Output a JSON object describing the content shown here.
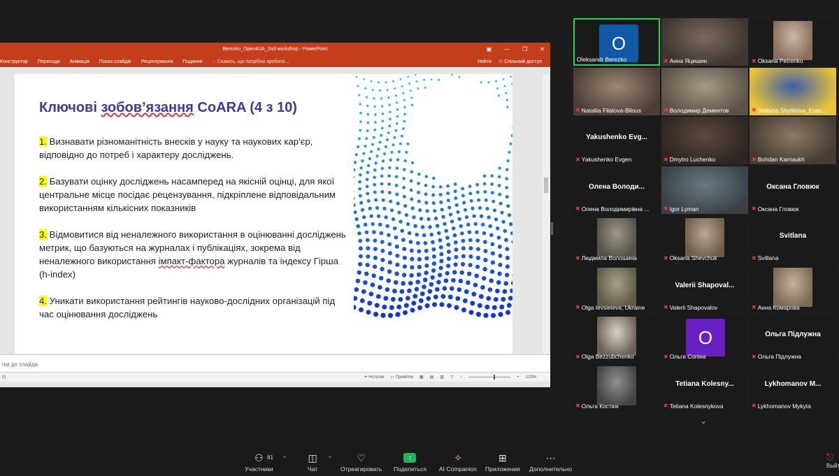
{
  "ppt": {
    "window_title": "Berezko_Open4UA_2nd-workshop - PowerPoint",
    "ribbon_tabs": [
      "Конструктор",
      "Переходи",
      "Анімація",
      "Показ слайдів",
      "Рецензування",
      "Подання"
    ],
    "tell_me": "Скажіть, що потрібно зробити...",
    "share_label": "Спільний доступ",
    "help_label": "Увійти",
    "notes_placeholder": "тки до слайда",
    "status_left": "ті)",
    "status_notes": "Нотатки",
    "status_comments": "Примітки",
    "zoom": "123%"
  },
  "slide": {
    "title_a": "Ключові ",
    "title_b": "зобов’язання",
    "title_c": " CoARA (4 з 10)",
    "points": [
      {
        "num": "1.",
        "text": " Визнавати різноманітність внесків у науку та наукових кар'єр, відповідно до потреб і характеру досліджень."
      },
      {
        "num": "2.",
        "text": " Базувати оцінку досліджень насамперед на якісній оцінці, для якої центральне місце посідає рецензування, підкріплене відповідальним використанням кількісних показників"
      },
      {
        "num": "3.",
        "text_a": " Відмовитися від неналежного використання в оцінюванні досліджень метрик, що базуються на журналах і публікаціях, зокрема від неналежного використання ",
        "text_b": "імпакт-фактора",
        "text_c": " журналів та індексу Гірша (h-index)"
      },
      {
        "num": "4.",
        "text": " Уникати використання рейтингів науково-дослідних організацій під час оцінювання досліджень"
      }
    ]
  },
  "participants": [
    {
      "name": "Oleksandr Berezko",
      "type": "avatar",
      "letter": "O",
      "color": "#0e5aa7",
      "muted": false,
      "speaking": true
    },
    {
      "name": "Анна Яцишин",
      "type": "photo",
      "muted": true
    },
    {
      "name": "Oksana Petrenko",
      "type": "photo",
      "muted": true
    },
    {
      "name": "Nataliia Filatova-Bilous",
      "type": "photo",
      "muted": true
    },
    {
      "name": "Володимир Дементов",
      "type": "photo",
      "muted": true
    },
    {
      "name": "Svitlana Shytikova_Eras...",
      "type": "photo",
      "muted": true
    },
    {
      "name": "Yakushenko Evgen",
      "type": "text",
      "big": "Yakushenko Evg...",
      "muted": true
    },
    {
      "name": "Dmytro Luchenko",
      "type": "photo",
      "muted": true
    },
    {
      "name": "Bohdan Karnaukh",
      "type": "photo",
      "muted": true
    },
    {
      "name": "Олена Володимирівна ...",
      "type": "text",
      "big": "Олена Володи...",
      "muted": true
    },
    {
      "name": "Igor Lyman",
      "type": "photo",
      "muted": true
    },
    {
      "name": "Оксана Гловюк",
      "type": "text",
      "big": "Оксана Гловюк",
      "muted": true
    },
    {
      "name": "Людмила Волошина",
      "type": "photo",
      "muted": true
    },
    {
      "name": "Oksana Shevchuk",
      "type": "photo",
      "muted": true
    },
    {
      "name": "Svitlana",
      "type": "text",
      "big": "Svitlana",
      "muted": true
    },
    {
      "name": "Olga Ievsieieva, Ukraine",
      "type": "photo",
      "muted": true
    },
    {
      "name": "Valerii Shapovalov",
      "type": "text",
      "big": "Valerii Shapoval...",
      "muted": true
    },
    {
      "name": "Анна Комарова",
      "type": "photo",
      "muted": true
    },
    {
      "name": "Olga Bezzubchenko",
      "type": "photo",
      "muted": true
    },
    {
      "name": "Ольга Сопіна",
      "type": "avatar",
      "letter": "O",
      "color": "#6a1fc2",
      "muted": true
    },
    {
      "name": "Ольга Підлужна",
      "type": "text",
      "big": "Ольга Підлужна",
      "muted": true
    },
    {
      "name": "Ольга Костюк",
      "type": "photo",
      "muted": true
    },
    {
      "name": "Tetiana Kolesnykova",
      "type": "text",
      "big": "Tetiana Kolesny...",
      "muted": true
    },
    {
      "name": "Lykhomanov Mykyta",
      "type": "text",
      "big": "Lykhomanov M...",
      "muted": true
    }
  ],
  "toolbar": {
    "participants_count": "81",
    "participants_label": "Участники",
    "chat_label": "Чат",
    "react_label": "Отреагировать",
    "share_label": "Поделиться",
    "ai_label": "AI Companion",
    "apps_label": "Приложения",
    "more_label": "Дополнительно",
    "leave_label": "Выйти"
  }
}
